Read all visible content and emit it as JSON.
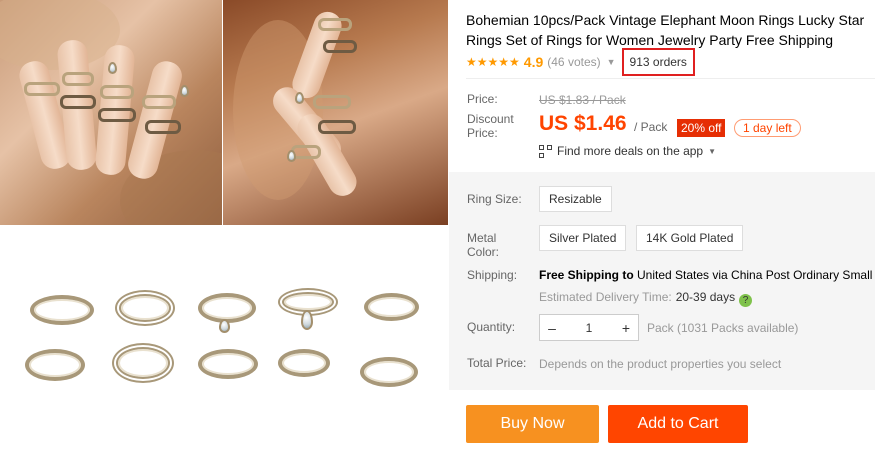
{
  "product": {
    "title_line1": "Bohemian 10pcs/Pack Vintage Elephant Moon Rings Lucky Star",
    "title_line2": "Rings Set of Rings for Women Jewelry Party Free Shipping",
    "stars": "★★★★★",
    "rating": "4.9",
    "votes": "(46 votes)",
    "orders": "913 orders"
  },
  "price": {
    "price_label": "Price:",
    "original": "US $1.83 / Pack",
    "discount_label_1": "Discount",
    "discount_label_2": "Price:",
    "current": "US $1.46",
    "unit": "/ Pack",
    "off_badge": "20% off",
    "time_left": "1 day left",
    "deals_link": "Find more deals on the app"
  },
  "options": {
    "ring_size_label": "Ring Size:",
    "ring_size_value": "Resizable",
    "metal_label_1": "Metal",
    "metal_label_2": "Color:",
    "metal_options": [
      "Silver Plated",
      "14K Gold Plated"
    ]
  },
  "shipping": {
    "label": "Shipping:",
    "free": "Free Shipping to",
    "destination": " United States via China Post Ordinary Small",
    "estimate_label": "Estimated Delivery Time:",
    "estimate_value": "20-39 days"
  },
  "quantity": {
    "label": "Quantity:",
    "value": "1",
    "minus": "–",
    "plus": "+",
    "availability": "Pack (1031 Packs available)"
  },
  "total": {
    "label": "Total Price:",
    "value": "Depends on the product properties you select"
  },
  "actions": {
    "buy_now": "Buy Now",
    "add_to_cart": "Add to Cart"
  },
  "colors": {
    "accent": "#ff4400",
    "buy": "#f79120",
    "cart": "#ff4500",
    "star": "#ff9900",
    "highlight_box": "#e02020"
  }
}
